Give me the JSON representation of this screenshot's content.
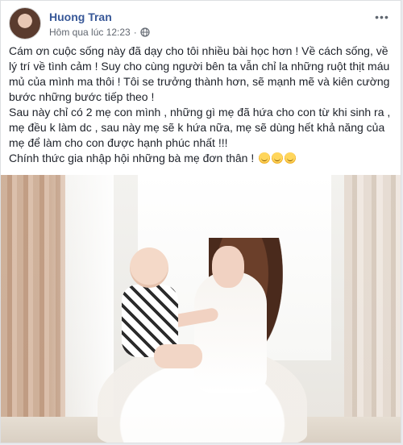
{
  "post": {
    "author": "Huong Tran",
    "timestamp": "Hôm qua lúc 12:23",
    "separator": "·",
    "privacy_icon": "globe-icon",
    "more_icon": "more-options-icon",
    "more_label": "•••",
    "paragraphs": [
      "Cám ơn cuộc sống này đã dạy cho tôi nhiều bài học hơn ! Về cách sống, về lý trí về tình cảm ! Suy cho cùng người bên ta vẫn chỉ la những ruột thịt máu mủ của mình ma thôi ! Tôi se trưởng thành hơn, sẽ mạnh mẽ và kiên cường bước những bước tiếp theo !",
      "Sau này chỉ có 2 mẹ con mình , những gì mẹ đã hứa cho con từ khi sinh ra , mẹ đều k làm dc , sau này mẹ sẽ k hứa nữa, mẹ sẽ dùng hết khả năng của mẹ để làm cho con được hạnh phúc nhất !!!",
      "Chính thức gia nhập hội những bà mẹ đơn thân !"
    ],
    "emoji_icon": "smiling-face-emoji",
    "photo_icon": "post-photo"
  },
  "colors": {
    "author": "#385898",
    "text": "#1d2129",
    "meta": "#616770",
    "background": "#e9ebee"
  }
}
